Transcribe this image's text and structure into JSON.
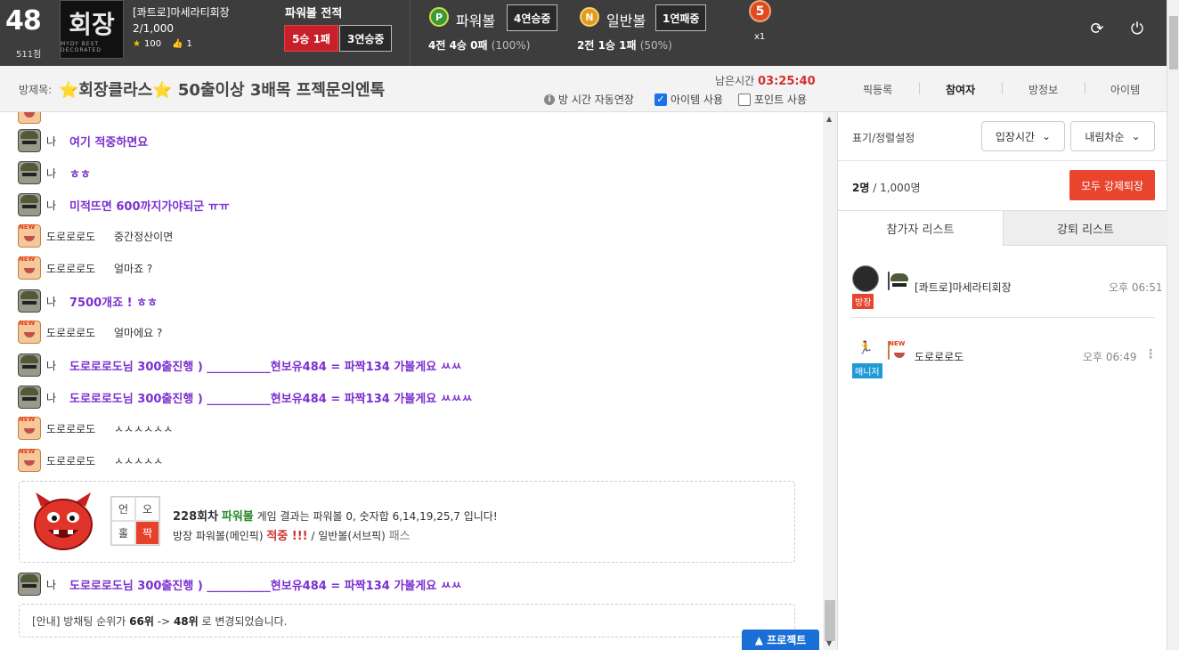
{
  "top": {
    "level": "48",
    "points": "511점",
    "logo_text": "회장",
    "logo_sub": "MYDY BEST DECORATED",
    "host_name": "[콰트로]마세라티회장",
    "host_count": "2/1,000",
    "stars": "100",
    "likes": "1",
    "record_title": "파워볼 전적",
    "record_badge1": "5승 1패",
    "record_badge2": "3연승중",
    "powerball_icon": "P",
    "powerball_label": "파워볼",
    "powerball_streak": "4연승중",
    "powerball_stat": "4전 4승 0패",
    "powerball_pct": "(100%)",
    "normal_icon": "N",
    "normal_label": "일반볼",
    "normal_streak": "1연패중",
    "normal_stat": "2전 1승 1패",
    "normal_pct": "(50%)",
    "mult_num": "5",
    "mult_txt": "x1"
  },
  "titlebar": {
    "label": "방제목:",
    "room_title": "⭐회장클라스⭐ 50출이상 3배목 프젝문의엔톡",
    "timer_label": "남은시간",
    "timer_value": "03:25:40",
    "opt_auto": "방 시간 자동연장",
    "opt_item": "아이템 사용",
    "opt_point": "포인트 사용",
    "tabs": [
      "픽등록",
      "참여자",
      "방정보",
      "아이템"
    ]
  },
  "chat": {
    "messages": [
      {
        "nick": "나",
        "text": "여기 적중하면요"
      },
      {
        "nick": "나",
        "text": "ㅎㅎ"
      },
      {
        "nick": "나",
        "text": "미적뜨면 600까지가야되군 ㅠㅠ"
      },
      {
        "nick": "도로로로도",
        "text": "중간정산이면"
      },
      {
        "nick": "도로로로도",
        "text": "얼마죠 ?"
      },
      {
        "nick": "나",
        "text": "7500개죠 ! ㅎㅎ"
      },
      {
        "nick": "도로로로도",
        "text": "얼마에요 ?"
      },
      {
        "nick": "나",
        "text": "도로로로도님 300출진행 ) ___________현보유484 = 파짝134 가볼게요 ㅆㅆ"
      },
      {
        "nick": "나",
        "text": "도로로로도님 300출진행 ) ___________현보유484 = 파짝134 가볼게요 ㅆㅆㅆ"
      },
      {
        "nick": "도로로로도",
        "text": "ㅅㅅㅅㅅㅅㅅ"
      },
      {
        "nick": "도로로로도",
        "text": "ㅅㅅㅅㅅㅅ"
      },
      {
        "nick": "나",
        "text": "도로로로도님 300출진행 ) ___________현보유484 = 파짝134 가볼게요 ㅆㅆ"
      }
    ],
    "result": {
      "grid": [
        "언",
        "오",
        "홀",
        "짝"
      ],
      "round": "228회차",
      "game": "파워볼",
      "line1_rest": "게임 결과는 파워볼 0, 숫자합 6,14,19,25,7 입니다!",
      "line2_a": "방장 파워볼(메인픽)",
      "line2_hit": "적중 !!!",
      "line2_b": "/ 일반볼(서브픽)",
      "line2_pass": "패스"
    },
    "notice": {
      "prefix": "[안내] 방채팅 순위가",
      "from": "66위",
      "arrow": "->",
      "to": "48위",
      "suffix": "로 변경되었습니다."
    },
    "project_btn": "▲ 프로젝트"
  },
  "panel": {
    "sort_label": "표기/정렬설정",
    "sort_select1": "입장시간",
    "sort_select2": "내림차순",
    "count_now": "2명",
    "count_sep": "/",
    "count_max": "1,000명",
    "kick_all": "모두 강제퇴장",
    "tab_participants": "참가자 리스트",
    "tab_kicked": "강퇴 리스트",
    "participants": [
      {
        "role": "방장",
        "name": "[콰트로]마세라티회장",
        "time": "오후 06:51"
      },
      {
        "role": "매니저",
        "name": "도로로로도",
        "time": "오후 06:49"
      }
    ]
  },
  "colors": {
    "topbar": "#3d3d3d",
    "accent_red": "#e8442e",
    "me_text": "#7b2fd0",
    "project_blue": "#1a6fd6"
  }
}
